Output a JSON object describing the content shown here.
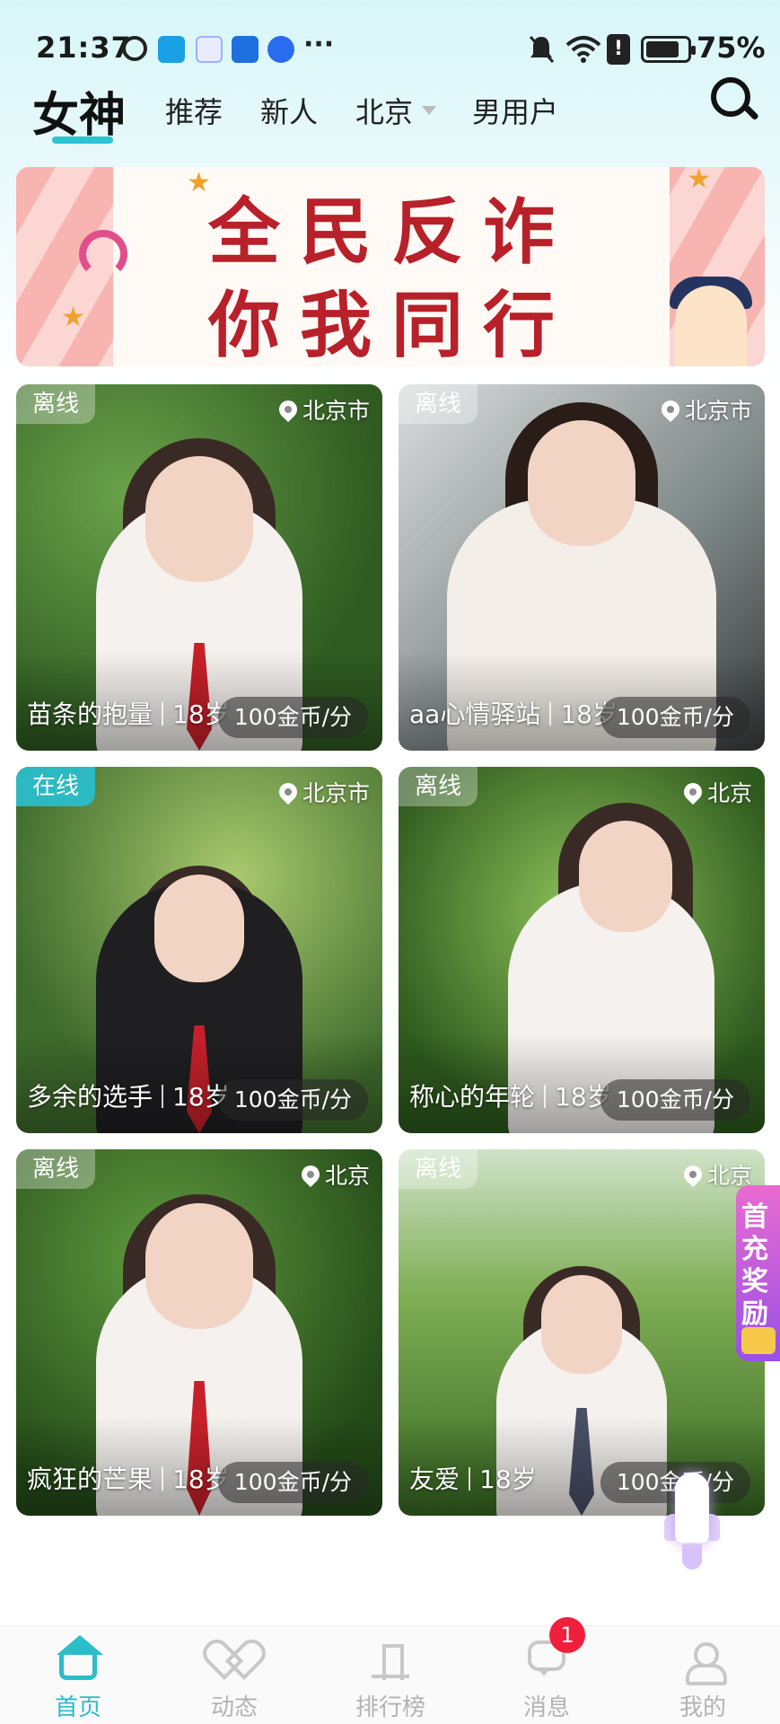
{
  "status_bar": {
    "time": "21:37",
    "more": "···",
    "battery": "75%"
  },
  "top_nav": {
    "tabs": [
      {
        "label": "女神",
        "active": true
      },
      {
        "label": "推荐",
        "active": false
      },
      {
        "label": "新人",
        "active": false
      },
      {
        "label": "北京",
        "active": false
      },
      {
        "label": "男用户",
        "active": false
      }
    ]
  },
  "banner": {
    "line1": "全民反诈",
    "line2": "你我同行"
  },
  "cards": [
    {
      "status": "离线",
      "location": "北京市",
      "name": "苗条的抱量",
      "age": "18岁",
      "price": "100金币/分"
    },
    {
      "status": "离线",
      "location": "北京市",
      "name": "aa心情驿站",
      "age": "18岁",
      "price": "100金币/分"
    },
    {
      "status": "在线",
      "location": "北京市",
      "name": "多余的选手",
      "age": "18岁",
      "price": "100金币/分"
    },
    {
      "status": "离线",
      "location": "北京",
      "name": "称心的年轮",
      "age": "18岁",
      "price": "100金币/分"
    },
    {
      "status": "离线",
      "location": "北京",
      "name": "疯狂的芒果",
      "age": "18岁",
      "price": "100金币/分"
    },
    {
      "status": "离线",
      "location": "北京",
      "name": "友爱",
      "age": "18岁",
      "price": "100金币/分"
    }
  ],
  "reward_tab": {
    "label": "首充奖励"
  },
  "bottom_nav": {
    "items": [
      {
        "label": "首页",
        "icon": "home-icon",
        "active": true
      },
      {
        "label": "动态",
        "icon": "heart-icon",
        "active": false
      },
      {
        "label": "排行榜",
        "icon": "rank-icon",
        "active": false
      },
      {
        "label": "消息",
        "icon": "message-icon",
        "active": false,
        "badge": "1"
      },
      {
        "label": "我的",
        "icon": "profile-icon",
        "active": false
      }
    ]
  },
  "colors": {
    "accent": "#2bbdca",
    "online_tag": "#2cb9c2",
    "badge": "#f0203c",
    "banner_text": "#b8202a"
  }
}
